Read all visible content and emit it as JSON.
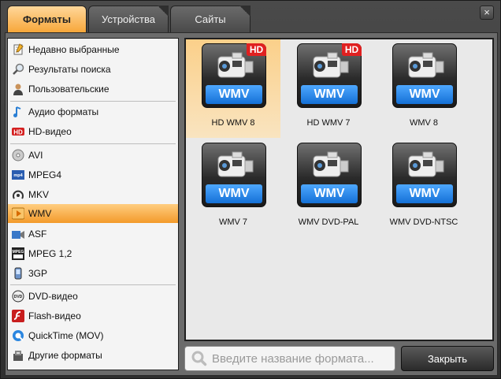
{
  "tabs": [
    {
      "label": "Форматы",
      "active": true
    },
    {
      "label": "Устройства",
      "active": false
    },
    {
      "label": "Сайты",
      "active": false
    }
  ],
  "window": {
    "close_glyph": "×"
  },
  "sidebar": {
    "items": [
      {
        "label": "Недавно выбранные",
        "icon": "recent-icon"
      },
      {
        "label": "Результаты поиска",
        "icon": "search-results-icon"
      },
      {
        "label": "Пользовательские",
        "icon": "user-icon"
      },
      {
        "label": "Аудио форматы",
        "icon": "music-note-icon"
      },
      {
        "label": "HD-видео",
        "icon": "hd-icon"
      },
      {
        "label": "AVI",
        "icon": "avi-disc-icon"
      },
      {
        "label": "MPEG4",
        "icon": "mpeg4-icon"
      },
      {
        "label": "MKV",
        "icon": "mkv-icon"
      },
      {
        "label": "WMV",
        "icon": "wmv-play-icon",
        "selected": true
      },
      {
        "label": "ASF",
        "icon": "asf-icon"
      },
      {
        "label": "MPEG 1,2",
        "icon": "mpeg-icon"
      },
      {
        "label": "3GP",
        "icon": "phone-icon"
      },
      {
        "label": "DVD-видео",
        "icon": "dvd-icon"
      },
      {
        "label": "Flash-видео",
        "icon": "flash-icon"
      },
      {
        "label": "QuickTime (MOV)",
        "icon": "quicktime-icon"
      },
      {
        "label": "Другие форматы",
        "icon": "other-formats-icon"
      }
    ]
  },
  "formats": [
    {
      "label": "HD WMV 8",
      "badge": "WMV",
      "hd": "HD",
      "selected": true
    },
    {
      "label": "HD WMV 7",
      "badge": "WMV",
      "hd": "HD"
    },
    {
      "label": "WMV 8",
      "badge": "WMV"
    },
    {
      "label": "WMV 7",
      "badge": "WMV"
    },
    {
      "label": "WMV DVD-PAL",
      "badge": "WMV"
    },
    {
      "label": "WMV DVD-NTSC",
      "badge": "WMV"
    }
  ],
  "search": {
    "placeholder": "Введите название формата..."
  },
  "footer": {
    "close_label": "Закрыть"
  },
  "colors": {
    "accent": "#f7a73a",
    "wmv_blue": "#1470d6",
    "hd_red": "#e02020"
  }
}
